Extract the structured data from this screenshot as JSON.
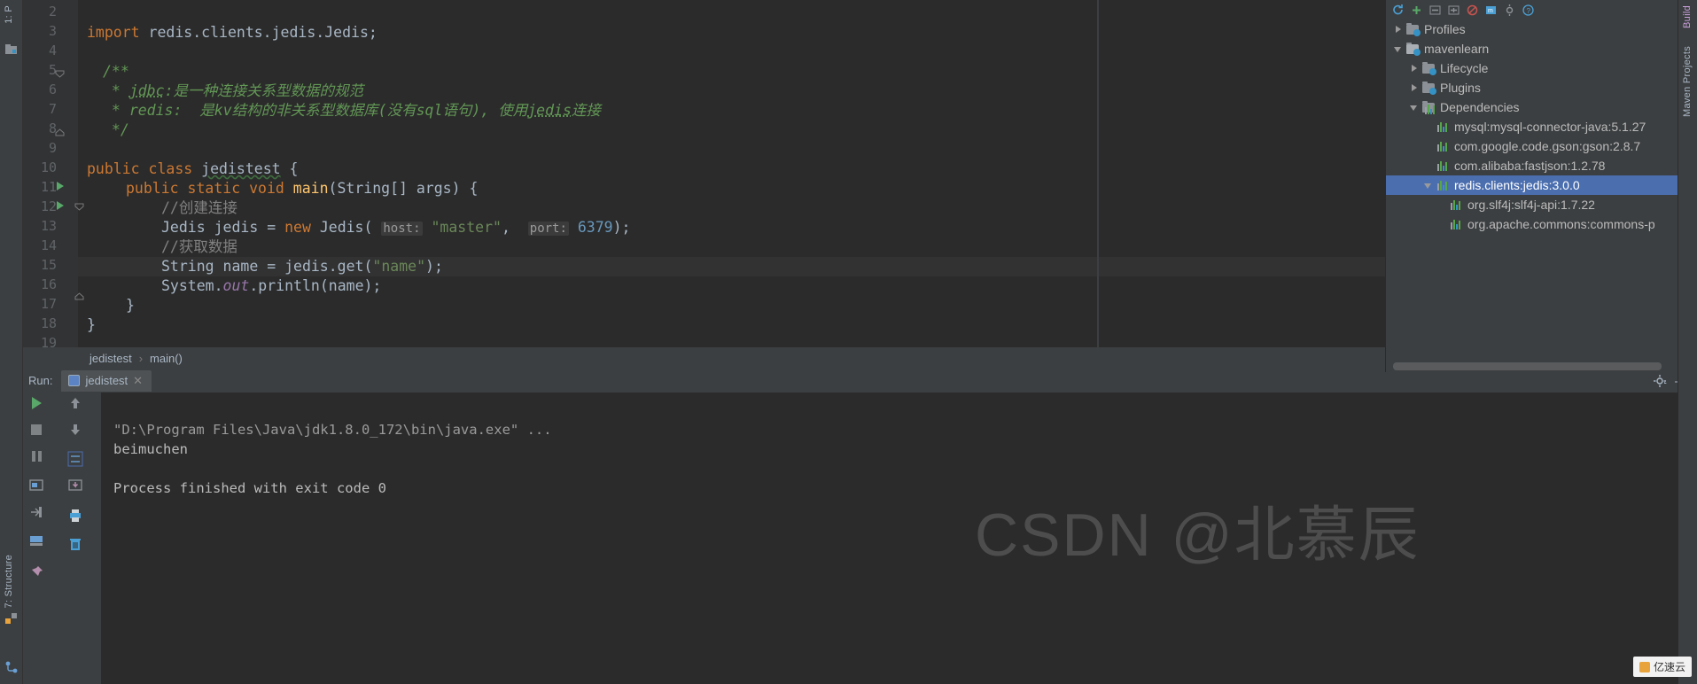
{
  "window": {
    "theme_bg": "#2b2b2b",
    "panel_bg": "#3c3f41",
    "accent": "#4b6eaf"
  },
  "left_strip": {
    "top_label": "1: P",
    "bottom_label": "7: Structure",
    "icons": [
      "project-icon",
      "structure-icon",
      "favorites-icon"
    ]
  },
  "editor": {
    "line_numbers": [
      "2",
      "3",
      "4",
      "5",
      "6",
      "7",
      "8",
      "9",
      "10",
      "11",
      "12",
      "13",
      "14",
      "15",
      "16",
      "17",
      "18",
      "19"
    ],
    "lines": [
      {
        "n": "2",
        "text": ""
      },
      {
        "n": "3",
        "text": "import redis.clients.jedis.Jedis;"
      },
      {
        "n": "4",
        "text": ""
      },
      {
        "n": "5",
        "text": "/**"
      },
      {
        "n": "6",
        "text": " * jdbc:是一种连接关系型数据的规范"
      },
      {
        "n": "7",
        "text": " * redis:  是kv结构的非关系型数据库(没有sql语句), 使用jedis连接"
      },
      {
        "n": "8",
        "text": " */"
      },
      {
        "n": "9",
        "text": ""
      },
      {
        "n": "10",
        "text": "public class jedistest {"
      },
      {
        "n": "11",
        "text": "    public static void main(String[] args) {"
      },
      {
        "n": "12",
        "text": "        //创建连接"
      },
      {
        "n": "13",
        "text": "        Jedis jedis = new Jedis( host: \"master\",  port: 6379);"
      },
      {
        "n": "14",
        "text": "        //获取数据"
      },
      {
        "n": "15",
        "text": "        String name = jedis.get(\"name\");"
      },
      {
        "n": "16",
        "text": "        System.out.println(name);"
      },
      {
        "n": "17",
        "text": "    }"
      },
      {
        "n": "18",
        "text": "}"
      },
      {
        "n": "19",
        "text": ""
      }
    ],
    "tokens": {
      "import_kw": "import",
      "import_path": " redis.clients.jedis.Jedis;",
      "jdoc_open": "/**",
      "jdoc_l6_star": " * ",
      "jdoc_l6_term": "jdbc",
      "jdoc_l6_rest": ":是一种连接关系型数据的规范",
      "jdoc_l7_star": " * ",
      "jdoc_l7_term": "redis",
      "jdoc_l7_mid": ":  是kv结构的非关系型数据库(没有sql语句), 使用",
      "jdoc_l7_term2": "jedis",
      "jdoc_l7_end": "连接",
      "jdoc_close": " */",
      "public_kw": "public",
      "class_kw": "class",
      "class_name": "jedistest",
      "brace_open": "{",
      "static_kw": "static",
      "void_kw": "void",
      "main_name": "main",
      "main_sig": "(String[] args) {",
      "comment_create": "//创建连接",
      "jedis_decl": "Jedis jedis = ",
      "new_kw": "new",
      "jedis_ctor": " Jedis( ",
      "hint_host": "host:",
      "str_master": "\"master\"",
      "comma": ",  ",
      "hint_port": "port:",
      "num_6379": "6379",
      "paren_end": ");",
      "comment_get": "//获取数据",
      "string_decl": "String name = jedis.get(",
      "str_name": "\"name\"",
      "getend": ");",
      "sysout_a": "System.",
      "sysout_b": "out",
      "sysout_c": ".println(name);",
      "close_inner": "}",
      "close_outer": "}"
    }
  },
  "breadcrumb": {
    "class": "jedistest",
    "separator": "›",
    "method": "main()"
  },
  "run_panel": {
    "label": "Run:",
    "tab_title": "jedistest",
    "close_glyph": "✕",
    "toolbar_left": [
      "run-icon",
      "stop-icon",
      "pause-icon",
      "restore-layout-icon",
      "print-icon",
      "trash-icon"
    ],
    "toolbar_right": [
      "up-arrow-icon",
      "down-arrow-icon",
      "soft-wrap-icon",
      "scroll-to-end-icon"
    ],
    "settings_icon": "gear-icon",
    "minimize_glyph": "—",
    "console_lines": [
      "\"D:\\Program Files\\Java\\jdk1.8.0_172\\bin\\java.exe\" ...",
      "beimuchen",
      "",
      "Process finished with exit code 0"
    ]
  },
  "maven_panel": {
    "side_label": "Maven Projects",
    "build_label": "Build",
    "toolbar_icons": [
      "refresh-icon",
      "add-icon",
      "collapse-icon",
      "expand-icon",
      "skip-tests-icon",
      "execute-goal-icon",
      "settings-icon",
      "help-icon"
    ],
    "tree": [
      {
        "label": "Profiles",
        "indent": 0,
        "arrow": "right",
        "icon": "folder-profiles-icon",
        "selected": false
      },
      {
        "label": "mavenlearn",
        "indent": 0,
        "arrow": "down",
        "icon": "maven-module-icon",
        "selected": false
      },
      {
        "label": "Lifecycle",
        "indent": 1,
        "arrow": "right",
        "icon": "folder-gear-icon",
        "selected": false
      },
      {
        "label": "Plugins",
        "indent": 1,
        "arrow": "right",
        "icon": "folder-gear-icon",
        "selected": false
      },
      {
        "label": "Dependencies",
        "indent": 1,
        "arrow": "down",
        "icon": "folder-bars-icon",
        "selected": false
      },
      {
        "label": "mysql:mysql-connector-java:5.1.27",
        "indent": 2,
        "arrow": "none",
        "icon": "library-bars-icon",
        "selected": false
      },
      {
        "label": "com.google.code.gson:gson:2.8.7",
        "indent": 2,
        "arrow": "none",
        "icon": "library-bars-icon",
        "selected": false
      },
      {
        "label": "com.alibaba:fastjson:1.2.78",
        "indent": 2,
        "arrow": "none",
        "icon": "library-bars-icon",
        "selected": false
      },
      {
        "label": "redis.clients:jedis:3.0.0",
        "indent": 2,
        "arrow": "down",
        "icon": "library-bars-icon",
        "selected": true
      },
      {
        "label": "org.slf4j:slf4j-api:1.7.22",
        "indent": 3,
        "arrow": "none",
        "icon": "library-bars-icon",
        "selected": false
      },
      {
        "label": "org.apache.commons:commons-p",
        "indent": 3,
        "arrow": "none",
        "icon": "library-bars-icon",
        "selected": false
      }
    ]
  },
  "watermarks": {
    "csdn": "CSDN @北慕辰",
    "badge": "亿速云"
  }
}
